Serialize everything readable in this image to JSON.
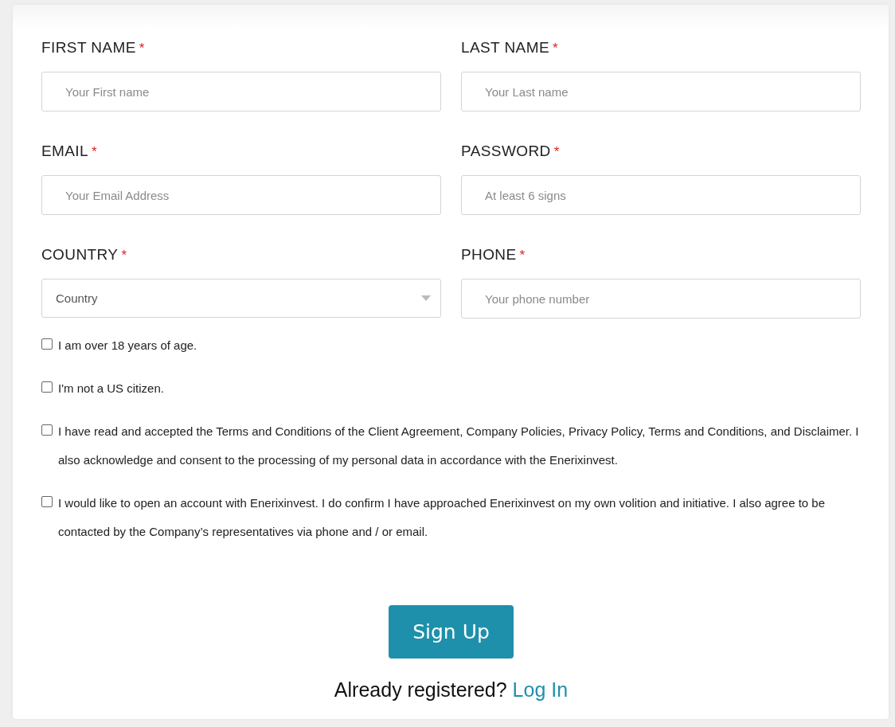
{
  "fields": [
    {
      "label": "FIRST NAME",
      "required_mark": "*",
      "kind": "text",
      "placeholder": "Your First name"
    },
    {
      "label": "LAST NAME",
      "required_mark": "*",
      "kind": "text",
      "placeholder": "Your Last name"
    },
    {
      "label": "EMAIL",
      "required_mark": "*",
      "kind": "text",
      "placeholder": "Your Email Address"
    },
    {
      "label": "PASSWORD",
      "required_mark": "*",
      "kind": "text",
      "placeholder": "At least 6 signs"
    },
    {
      "label": "COUNTRY",
      "required_mark": "*",
      "kind": "select",
      "value": "Country"
    },
    {
      "label": "PHONE",
      "required_mark": "*",
      "kind": "text",
      "placeholder": "Your phone number"
    }
  ],
  "agreements": [
    {
      "text": "I am over 18 years of age.",
      "checked": false
    },
    {
      "text": "I'm not a US citizen.",
      "checked": false
    },
    {
      "text": "I have read and accepted the Terms and Conditions of the Client Agreement, Company Policies, Privacy Policy, Terms and Conditions, and Disclaimer. I also acknowledge and consent to the processing of my personal data in accordance with the Enerixinvest.",
      "checked": false
    },
    {
      "text": "I would like to open an account with Enerixinvest. I do confirm I have approached Enerixinvest on my own volition and initiative. I also agree to be contacted by the Company’s representatives via phone and / or email.",
      "checked": false
    }
  ],
  "submit": {
    "label": "Sign Up"
  },
  "login": {
    "prompt": "Already registered?",
    "link": "Log In"
  }
}
